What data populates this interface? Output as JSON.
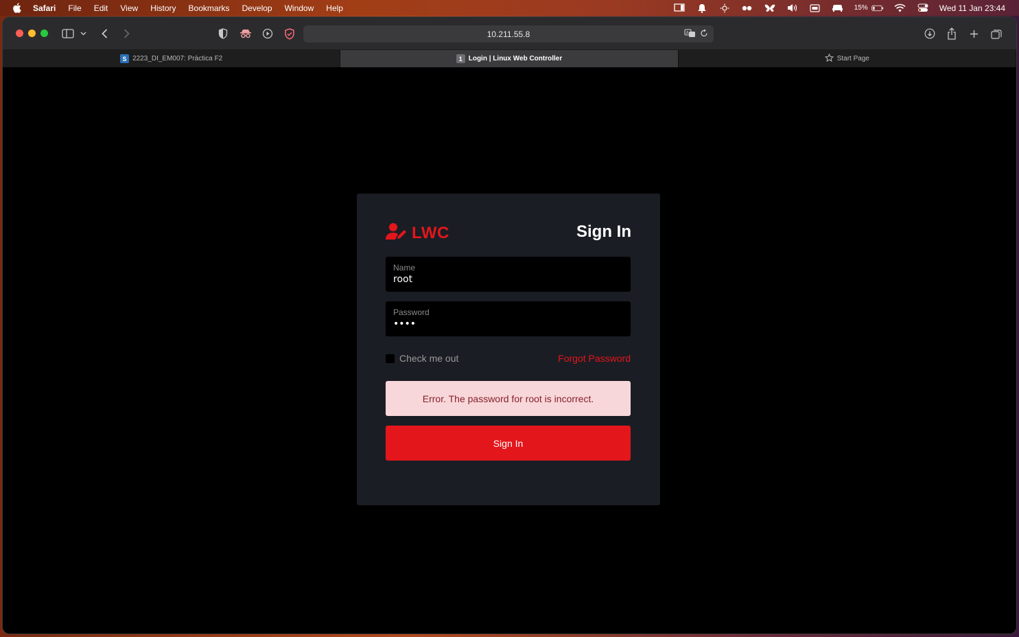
{
  "menubar": {
    "app": "Safari",
    "items": [
      "File",
      "Edit",
      "View",
      "History",
      "Bookmarks",
      "Develop",
      "Window",
      "Help"
    ],
    "battery": "15%",
    "clock": "Wed 11 Jan  23:44"
  },
  "browser": {
    "url": "10.211.55.8",
    "tabs": [
      {
        "label": "2223_DI_EM007: Pràctica F2",
        "favicon": "S",
        "active": false
      },
      {
        "label": "Login | Linux Web Controller",
        "favicon": "1",
        "active": true
      },
      {
        "label": "Start Page",
        "favicon": "star-icon",
        "active": false
      }
    ]
  },
  "login": {
    "brand": "LWC",
    "title": "Sign In",
    "name_label": "Name",
    "name_value": "root",
    "password_label": "Password",
    "password_value": "••••",
    "check_label": "Check me out",
    "forgot_label": "Forgot Password",
    "error": "Error. The password for root is incorrect.",
    "submit": "Sign In"
  },
  "colors": {
    "accent": "#e3161b",
    "card": "#1b1d24",
    "alert_bg": "#f8d7da",
    "alert_text": "#842029"
  }
}
